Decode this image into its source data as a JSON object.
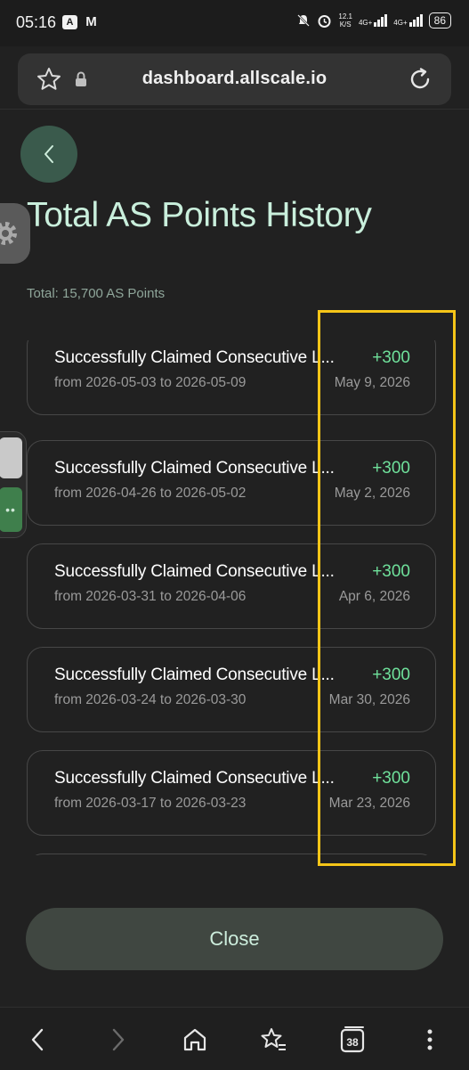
{
  "status_bar": {
    "time": "05:16",
    "app_icon_1": "A",
    "app_icon_2": "M",
    "net_speed_value": "12.1",
    "net_speed_unit": "K/S",
    "signal_1": "4G+",
    "signal_2": "4G+",
    "battery": "86"
  },
  "browser": {
    "url": "dashboard.allscale.io",
    "tab_count": "38"
  },
  "page": {
    "title": "Total AS Points History",
    "total": "Total: 15,700 AS Points",
    "close_label": "Close"
  },
  "history": [
    {
      "title": "Successfully Claimed Consecutive L...",
      "points": "+300",
      "range": "from 2026-05-03 to 2026-05-09",
      "date": "May 9, 2026"
    },
    {
      "title": "Successfully Claimed Consecutive L...",
      "points": "+300",
      "range": "from 2026-04-26 to 2026-05-02",
      "date": "May 2, 2026"
    },
    {
      "title": "Successfully Claimed Consecutive L...",
      "points": "+300",
      "range": "from 2026-03-31 to 2026-04-06",
      "date": "Apr 6, 2026"
    },
    {
      "title": "Successfully Claimed Consecutive L...",
      "points": "+300",
      "range": "from 2026-03-24 to 2026-03-30",
      "date": "Mar 30, 2026"
    },
    {
      "title": "Successfully Claimed Consecutive L...",
      "points": "+300",
      "range": "from 2026-03-17 to 2026-03-23",
      "date": "Mar 23, 2026"
    }
  ],
  "colors": {
    "accent_green": "#6fe19b",
    "title_mint": "#c9efdc",
    "highlight_yellow": "#f5c518",
    "background": "#212121"
  },
  "icons": {
    "bookmark": "star-icon",
    "lock": "lock-icon",
    "reload": "reload-icon",
    "back": "chevron-left-icon",
    "nav_back": "arrow-left-icon",
    "nav_forward": "arrow-right-icon",
    "home": "home-icon",
    "favorites": "star-list-icon",
    "tabs": "tabs-icon",
    "menu": "more-vertical-icon"
  }
}
